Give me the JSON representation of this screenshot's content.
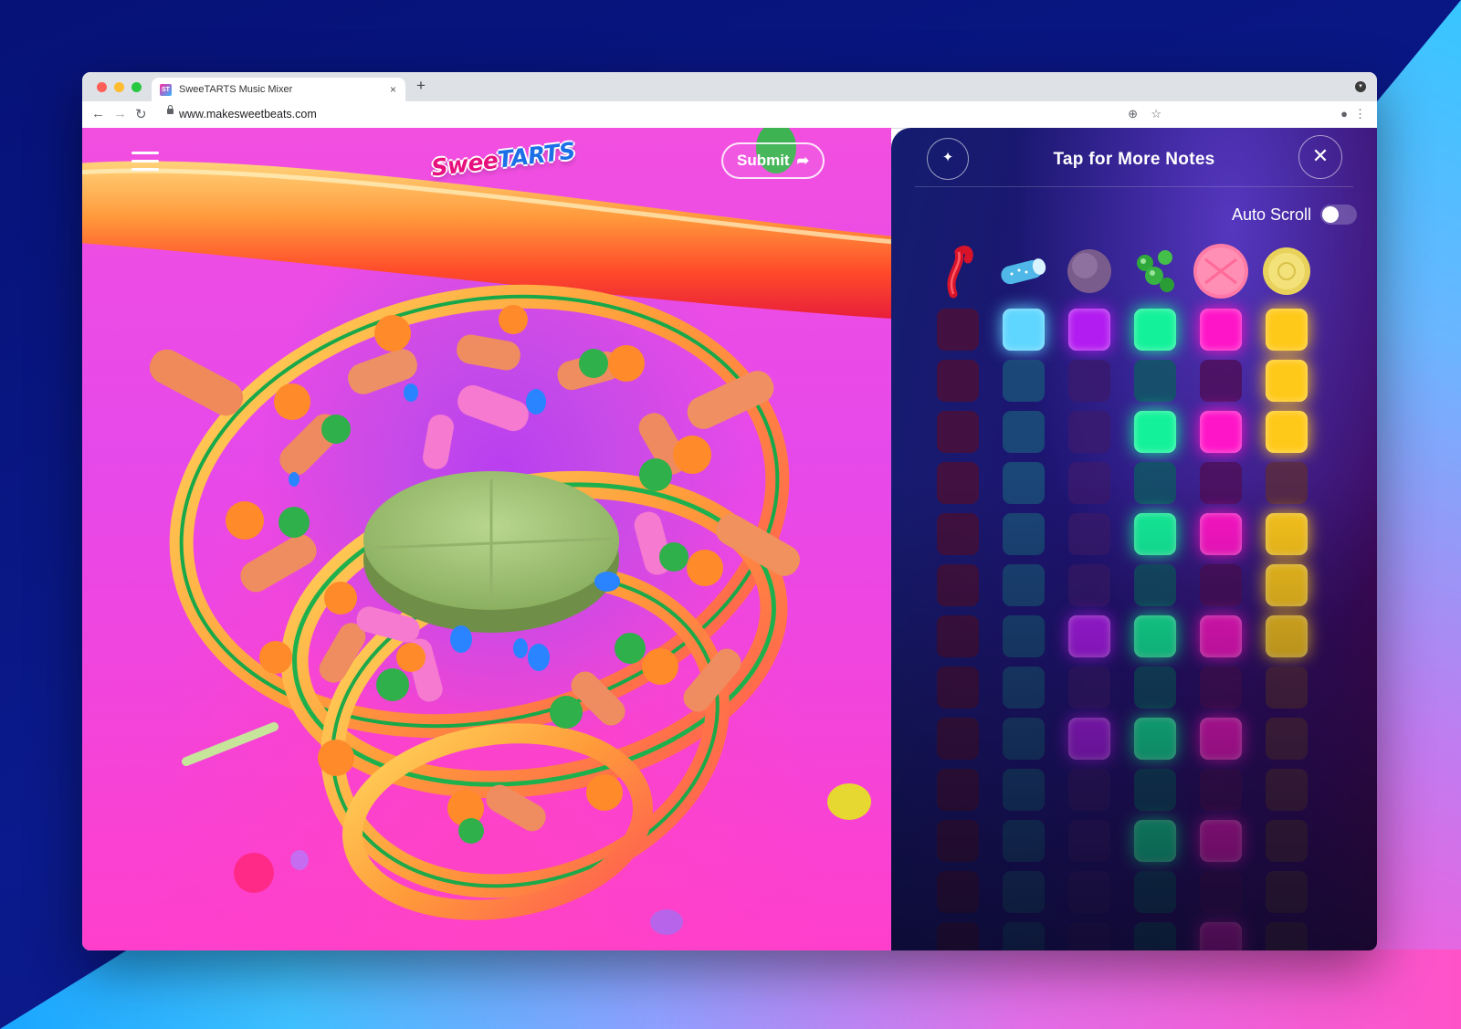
{
  "browser": {
    "tab_title": "SweeTARTS Music Mixer",
    "favicon_text": "ST",
    "new_tab": "+",
    "tab_close": "×",
    "url": "www.makesweetbeats.com"
  },
  "site": {
    "logo_part1": "Swee",
    "logo_part2": "TARTS",
    "submit_label": "Submit",
    "submit_icon": "share-arrow-icon"
  },
  "panel": {
    "title": "Tap for More Notes",
    "autoscroll_label": "Auto Scroll",
    "autoscroll_on": false,
    "sparkle_icon": "sparkle-icon",
    "close_icon": "close-icon"
  },
  "candies": [
    {
      "name": "red rope",
      "color": "#e0132b"
    },
    {
      "name": "blue rope bite",
      "color": "#54c6f0"
    },
    {
      "name": "purple round",
      "color": "#8a6a9a"
    },
    {
      "name": "green gummies",
      "color": "#3fbe3a"
    },
    {
      "name": "pink tablet",
      "color": "#ff7fa8"
    },
    {
      "name": "yellow tablet",
      "color": "#f2e06a"
    }
  ],
  "columns": [
    {
      "on": "#ff2b4e",
      "off": "#4a1038"
    },
    {
      "on": "#5fd6ff",
      "off": "#1b4f79"
    },
    {
      "on": "#b21cf0",
      "off": "#3a1a6e"
    },
    {
      "on": "#13f29a",
      "off": "#115664"
    },
    {
      "on": "#ff15c8",
      "off": "#4d0f5a"
    },
    {
      "on": "#ffc91a",
      "off": "#5a2c3e"
    }
  ],
  "grid": [
    [
      0,
      1,
      1,
      1,
      1,
      1
    ],
    [
      0,
      0,
      0,
      0,
      0,
      1
    ],
    [
      0,
      0,
      0,
      1,
      1,
      1
    ],
    [
      0,
      0,
      0,
      0,
      0,
      0
    ],
    [
      0,
      0,
      0,
      1,
      1,
      1
    ],
    [
      0,
      0,
      0,
      0,
      0,
      1
    ],
    [
      0,
      0,
      1,
      1,
      1,
      1
    ],
    [
      0,
      0,
      0,
      0,
      0,
      0
    ],
    [
      0,
      0,
      1,
      1,
      1,
      0
    ],
    [
      0,
      0,
      0,
      0,
      0,
      0
    ],
    [
      0,
      0,
      0,
      1,
      1,
      0
    ],
    [
      0,
      0,
      0,
      0,
      0,
      0
    ],
    [
      0,
      0,
      0,
      0,
      1,
      0
    ]
  ]
}
